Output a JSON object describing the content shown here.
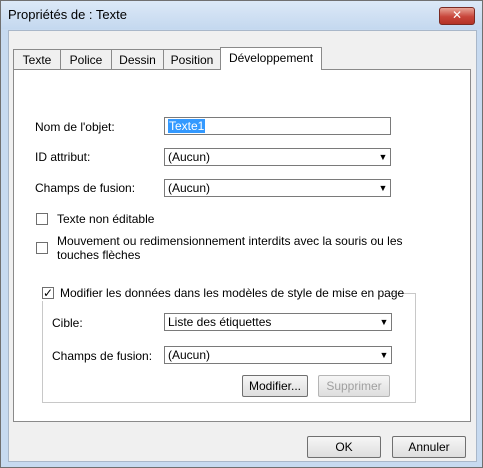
{
  "window": {
    "title": "Propriétés de : Texte",
    "close_glyph": "✕"
  },
  "tabs": [
    {
      "label": "Texte"
    },
    {
      "label": "Police"
    },
    {
      "label": "Dessin"
    },
    {
      "label": "Position"
    },
    {
      "label": "Développement",
      "active": true
    }
  ],
  "form": {
    "object_name_label": "Nom de l'objet:",
    "object_name_value": "Texte1",
    "id_attr_label": "ID attribut:",
    "id_attr_value": "(Aucun)",
    "merge_field_label": "Champs de fusion:",
    "merge_field_value": "(Aucun)",
    "non_editable_label": "Texte non éditable",
    "non_editable_checked": false,
    "move_resize_label_line1": "Mouvement ou redimensionnement interdits avec la souris ou les",
    "move_resize_label_line2": "touches flèches",
    "move_resize_checked": false
  },
  "group": {
    "title": "Modifier les données dans les modèles de style de mise en page",
    "checked": true,
    "check_glyph": "✓",
    "target_label": "Cible:",
    "target_value": "Liste des étiquettes",
    "merge_field_label": "Champs de fusion:",
    "merge_field_value": "(Aucun)",
    "modify_button": "Modifier...",
    "delete_button": "Supprimer"
  },
  "footer": {
    "ok_button": "OK",
    "cancel_button": "Annuler"
  },
  "icons": {
    "dropdown_arrow": "▼"
  },
  "colors": {
    "selection": "#3399ff",
    "close_button": "#c8453a"
  }
}
